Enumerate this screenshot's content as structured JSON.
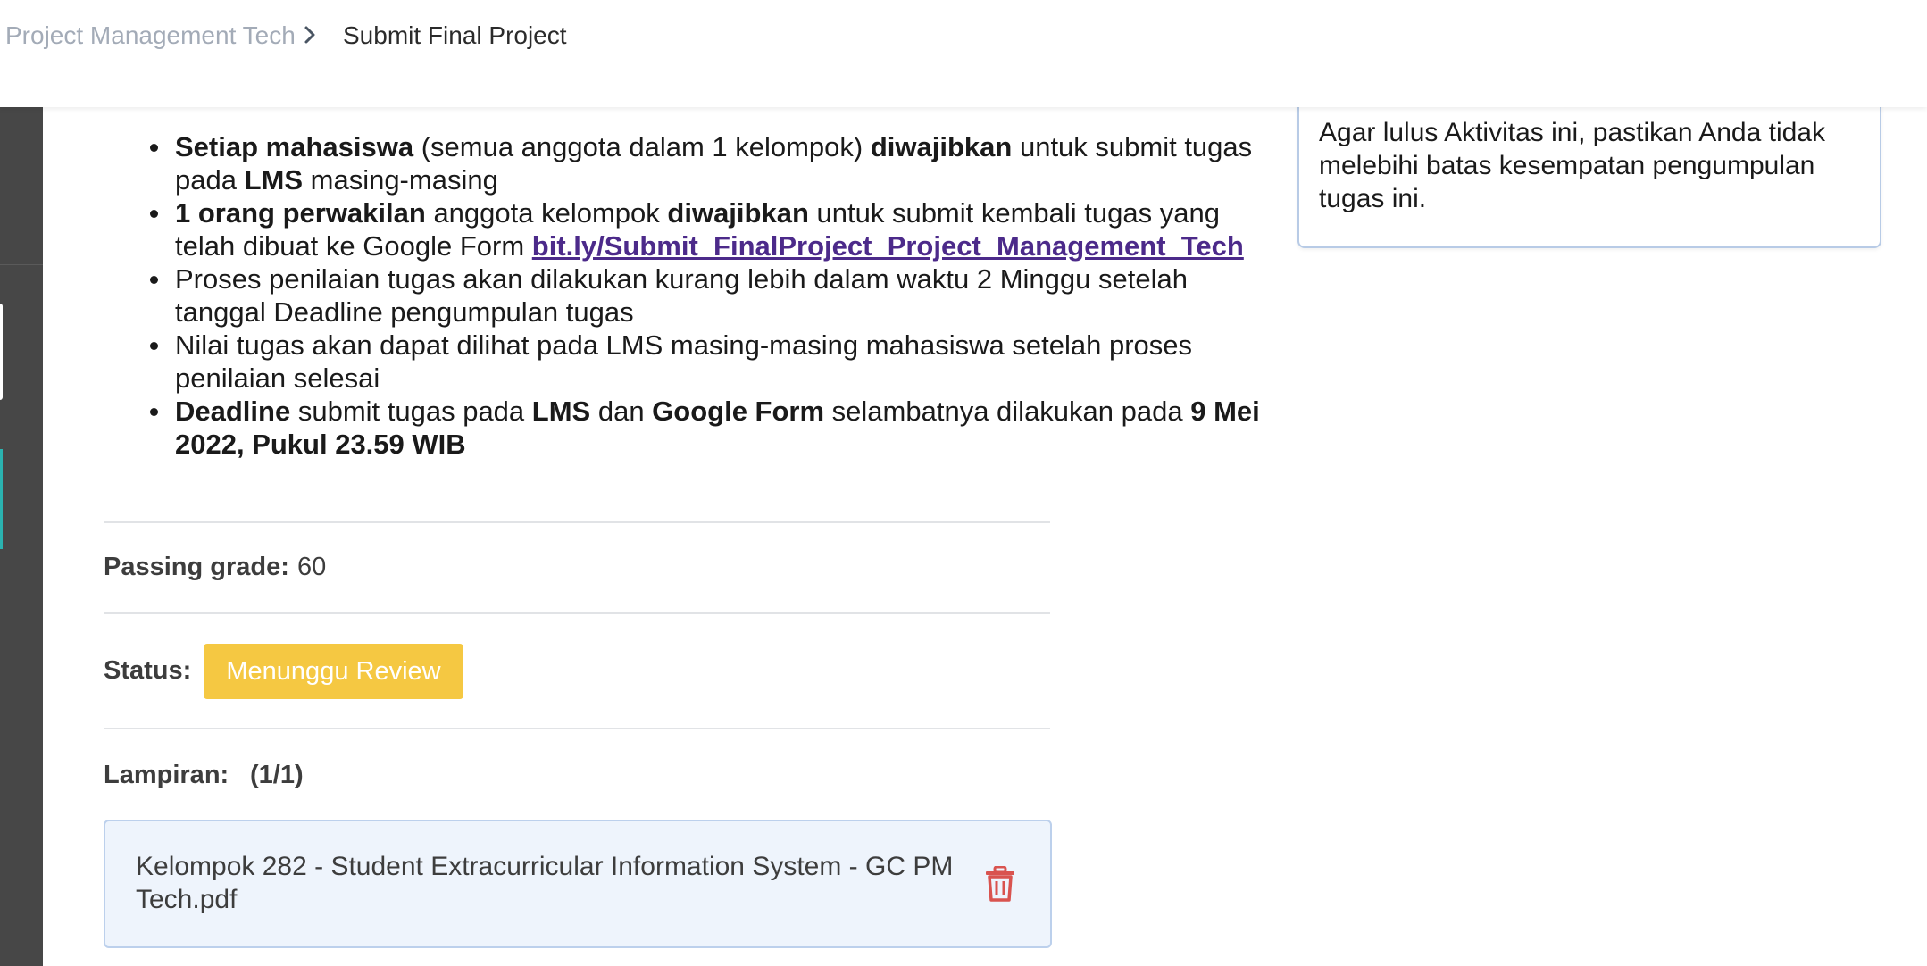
{
  "breadcrumb": {
    "parent": "Project Management Tech",
    "current": "Submit Final Project"
  },
  "instructions": {
    "item1": {
      "b1": "Setiap mahasiswa",
      "t1": " (semua anggota dalam 1 kelompok) ",
      "b2": "diwajibkan",
      "t2": " untuk submit tugas pada ",
      "b3": "LMS",
      "t3": " masing-masing"
    },
    "item2": {
      "b1": "1 orang perwakilan",
      "t1": " anggota kelompok ",
      "b2": "diwajibkan",
      "t2": " untuk submit kembali tugas yang telah dibuat ke Google Form  ",
      "link": "bit.ly/Submit_FinalProject_Project_Management_Tech"
    },
    "item3": "Proses penilaian tugas akan dilakukan kurang lebih dalam waktu 2 Minggu setelah tanggal Deadline pengumpulan tugas",
    "item4": "Nilai tugas akan dapat dilihat pada LMS masing-masing mahasiswa setelah proses penilaian selesai",
    "item5": {
      "b1": "Deadline",
      "t1": " submit tugas pada ",
      "b2": "LMS",
      "t2": " dan ",
      "b3": "Google Form",
      "t3": " selambatnya dilakukan pada ",
      "b4": "9 Mei 2022,  Pukul 23.59 WIB"
    }
  },
  "passing_grade": {
    "label": "Passing grade:",
    "value": "60"
  },
  "status": {
    "label": "Status:",
    "badge": "Menunggu Review",
    "badge_color": "#f5c842"
  },
  "attachments": {
    "label": "Lampiran:",
    "count": "(1/1)",
    "file_name": "Kelompok 282 - Student Extracurricular Information System - GC PM Tech.pdf",
    "delete_icon": "trash-icon",
    "delete_color": "#d9534f"
  },
  "info_box": {
    "text": "Agar lulus Aktivitas ini, pastikan Anda tidak melebihi batas kesempatan pengumpulan tugas ini."
  }
}
